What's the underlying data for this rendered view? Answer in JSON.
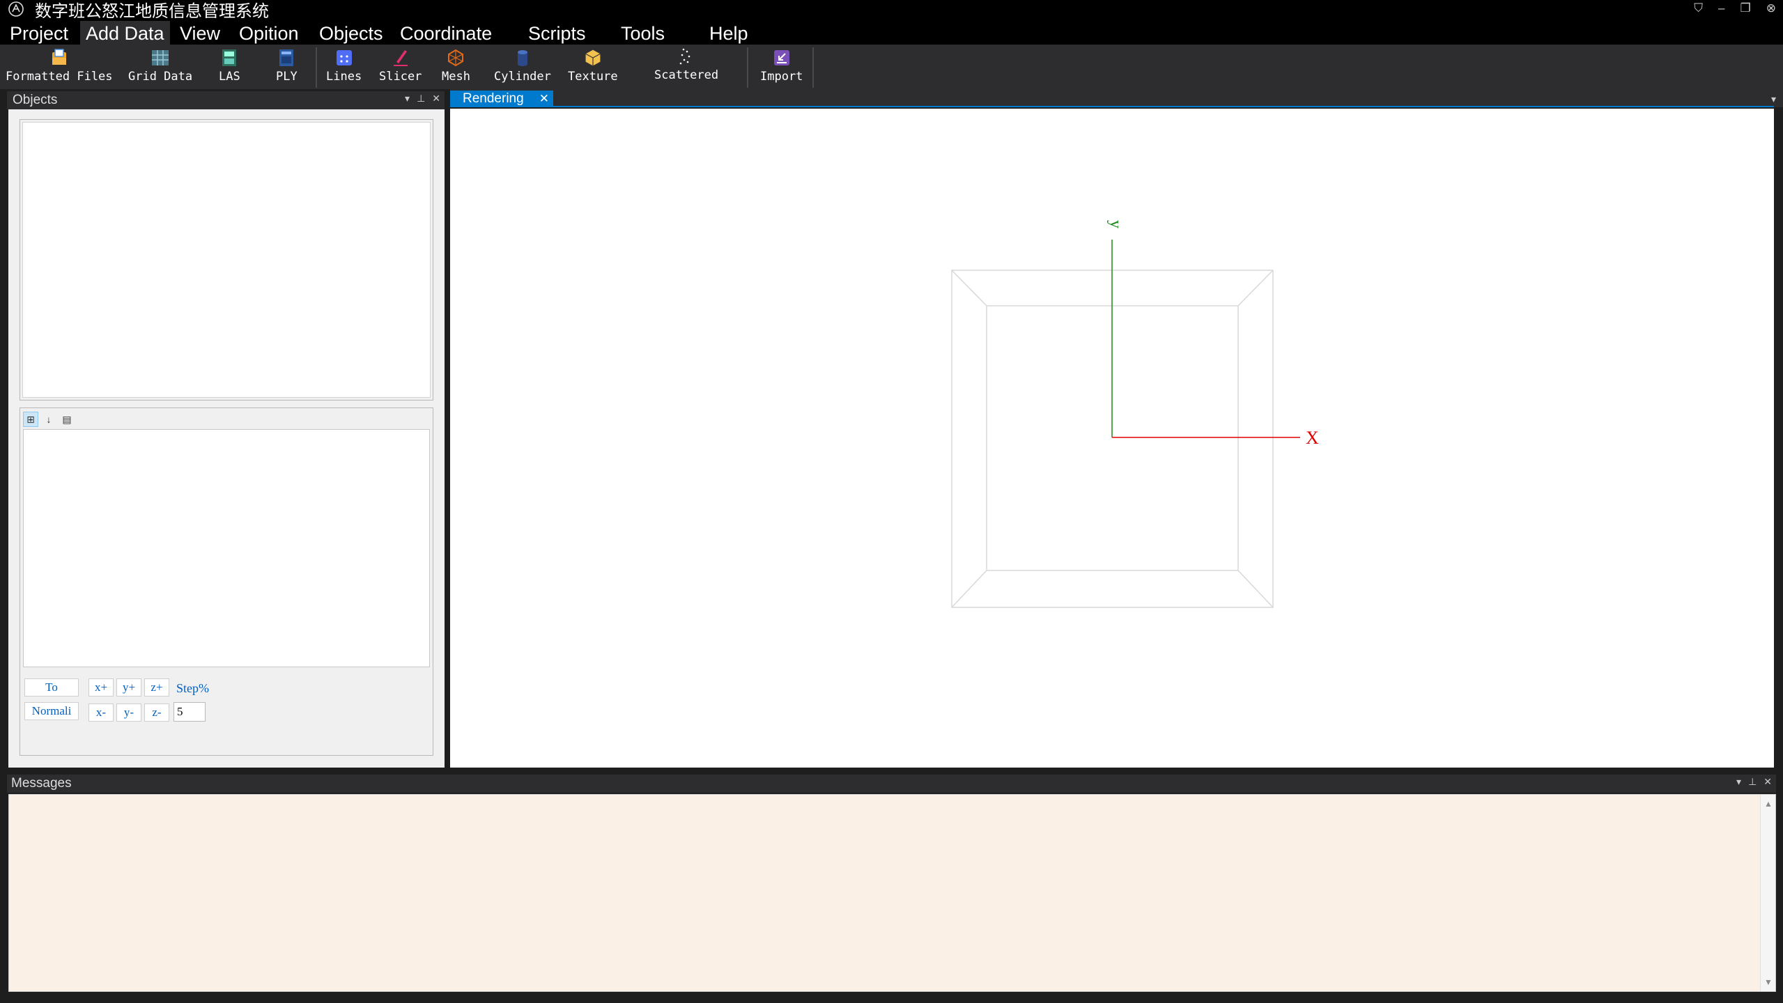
{
  "window": {
    "title": "数字班公怒江地质信息管理系统",
    "controls": [
      "shirt-icon",
      "minimize-icon",
      "restore-icon",
      "close-icon"
    ]
  },
  "menu": {
    "items": [
      "Project",
      "Add Data",
      "View",
      "Opition",
      "Objects",
      "Coordinate",
      "Scripts",
      "Tools",
      "Help"
    ],
    "active": "Add Data"
  },
  "toolbar": {
    "buttons": [
      {
        "label": "Formatted Files",
        "icon": "formatted-files-icon"
      },
      {
        "label": "Grid Data",
        "icon": "grid-data-icon"
      },
      {
        "label": "LAS",
        "icon": "las-icon"
      },
      {
        "label": "PLY",
        "icon": "ply-icon"
      },
      {
        "label": "Lines",
        "icon": "lines-icon"
      },
      {
        "label": "Slicer",
        "icon": "slicer-icon"
      },
      {
        "label": "Mesh",
        "icon": "mesh-icon"
      },
      {
        "label": "Cylinder",
        "icon": "cylinder-icon"
      },
      {
        "label": "Texture",
        "icon": "texture-icon"
      },
      {
        "label": "Scattered",
        "icon": "scattered-icon"
      },
      {
        "label": "Import",
        "icon": "import-icon"
      }
    ]
  },
  "objects_panel": {
    "title": "Objects",
    "controls": {
      "to": "To",
      "normal": "Normali",
      "x_plus": "x+",
      "y_plus": "y+",
      "z_plus": "z+",
      "x_minus": "x-",
      "y_minus": "y-",
      "z_minus": "z-",
      "step_label": "Step%",
      "step_value": "5"
    }
  },
  "rendering": {
    "tab_label": "Rendering",
    "axis_x_label": "X",
    "axis_y_label": "y",
    "colors": {
      "x_axis": "#e00000",
      "y_axis": "#1a8a1a",
      "box": "#d8d8d8"
    }
  },
  "messages": {
    "title": "Messages"
  },
  "colors": {
    "accent": "#007acc",
    "chrome": "#2d2d30",
    "messages_bg": "#faf0e6"
  }
}
